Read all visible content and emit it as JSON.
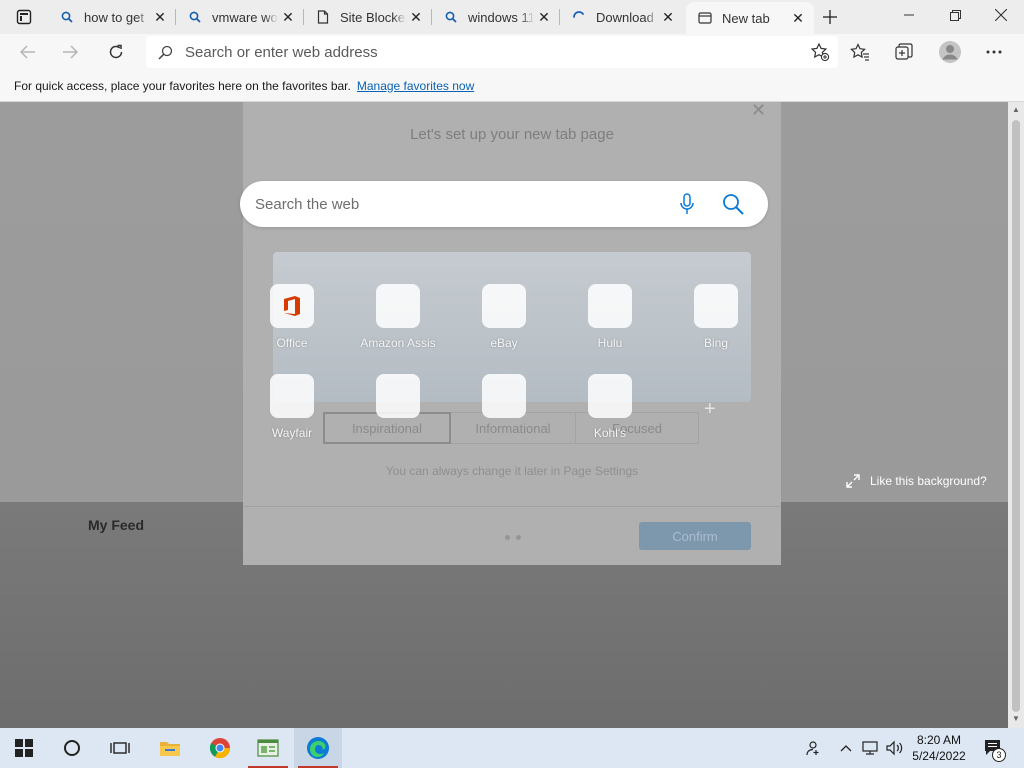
{
  "tabs": [
    {
      "title": "how to get",
      "icon": "search-icon",
      "close": "✕"
    },
    {
      "title": "vmware wo",
      "icon": "search-icon",
      "close": "✕"
    },
    {
      "title": "Site Blocker",
      "icon": "page-icon",
      "close": "✕"
    },
    {
      "title": "windows 11",
      "icon": "search-icon",
      "close": "✕"
    },
    {
      "title": "Download",
      "icon": "loading-icon",
      "close": "✕"
    },
    {
      "title": "New tab",
      "icon": "newtab-icon",
      "close": "✕",
      "active": true
    }
  ],
  "address_bar": {
    "placeholder": "Search or enter web address"
  },
  "favorites_bar": {
    "message": "For quick access, place your favorites here on the favorites bar.",
    "link": "Manage favorites now"
  },
  "setup_dialog": {
    "title": "Let's set up your new tab page",
    "layouts": [
      "Inspirational",
      "Informational",
      "Focused"
    ],
    "selected_layout": "Inspirational",
    "hint": "You can always change it later in Page Settings",
    "confirm": "Confirm"
  },
  "search": {
    "placeholder": "Search the web"
  },
  "quick_links": [
    {
      "label": "Office",
      "icon": "office-icon"
    },
    {
      "label": "Amazon Assis",
      "icon": "amazon-icon"
    },
    {
      "label": "eBay",
      "icon": "ebay-icon"
    },
    {
      "label": "Hulu",
      "icon": "hulu-icon"
    },
    {
      "label": "Bing",
      "icon": "bing-icon"
    },
    {
      "label": "Wayfair",
      "icon": "wayfair-icon"
    },
    {
      "label": "",
      "icon": "blank-tile"
    },
    {
      "label": "",
      "icon": "blank-tile"
    },
    {
      "label": "Kohl's",
      "icon": "kohls-icon"
    }
  ],
  "like_background": "Like this background?",
  "my_feed": "My Feed",
  "taskbar": {
    "apps": [
      "start-icon",
      "search-circle-icon",
      "task-view-icon",
      "file-explorer-icon",
      "chrome-icon",
      "notepad-window-icon",
      "edge-icon"
    ],
    "clock_time": "8:20 AM",
    "clock_date": "5/24/2022",
    "notification_count": "3"
  },
  "colors": {
    "edge_blue": "#0c7bd6",
    "link_blue": "#0b61b3",
    "taskbar_bg": "#dde7f3",
    "running_indicator": "#c0392b"
  }
}
